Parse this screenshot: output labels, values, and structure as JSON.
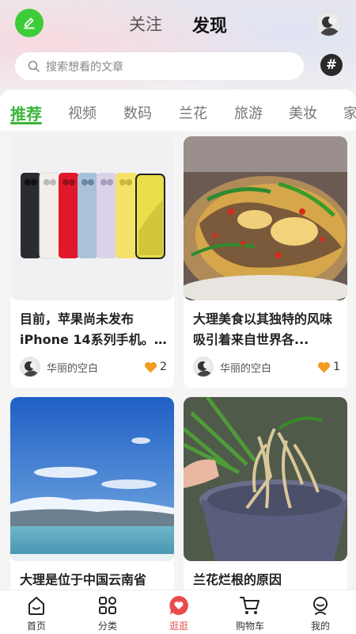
{
  "header": {
    "tabs": [
      "关注",
      "发现"
    ],
    "active_tab": "发现"
  },
  "search": {
    "placeholder": "搜索想看的文章"
  },
  "categories": [
    "推荐",
    "视频",
    "数码",
    "兰花",
    "旅游",
    "美妆",
    "家"
  ],
  "active_category": "推荐",
  "cards": [
    {
      "title": "目前，苹果尚未发布iPhone 14系列手机。根...",
      "author": "华丽的空白",
      "likes": "2"
    },
    {
      "title": "大理美食以其独特的风味吸引着来自世界各...",
      "author": "华丽的空白",
      "likes": "1"
    },
    {
      "title": "大理是位于中国云南省"
    },
    {
      "title": "兰花烂根的原因"
    }
  ],
  "bottom_nav": [
    {
      "label": "首页",
      "icon": "home-icon"
    },
    {
      "label": "分类",
      "icon": "grid-icon"
    },
    {
      "label": "逛逛",
      "icon": "heart-bubble-icon",
      "active": true
    },
    {
      "label": "购物车",
      "icon": "cart-icon"
    },
    {
      "label": "我的",
      "icon": "profile-icon"
    }
  ],
  "colors": {
    "accent_green": "#3ab53a",
    "accent_red": "#e94b4b",
    "like_orange": "#f39c1f"
  }
}
